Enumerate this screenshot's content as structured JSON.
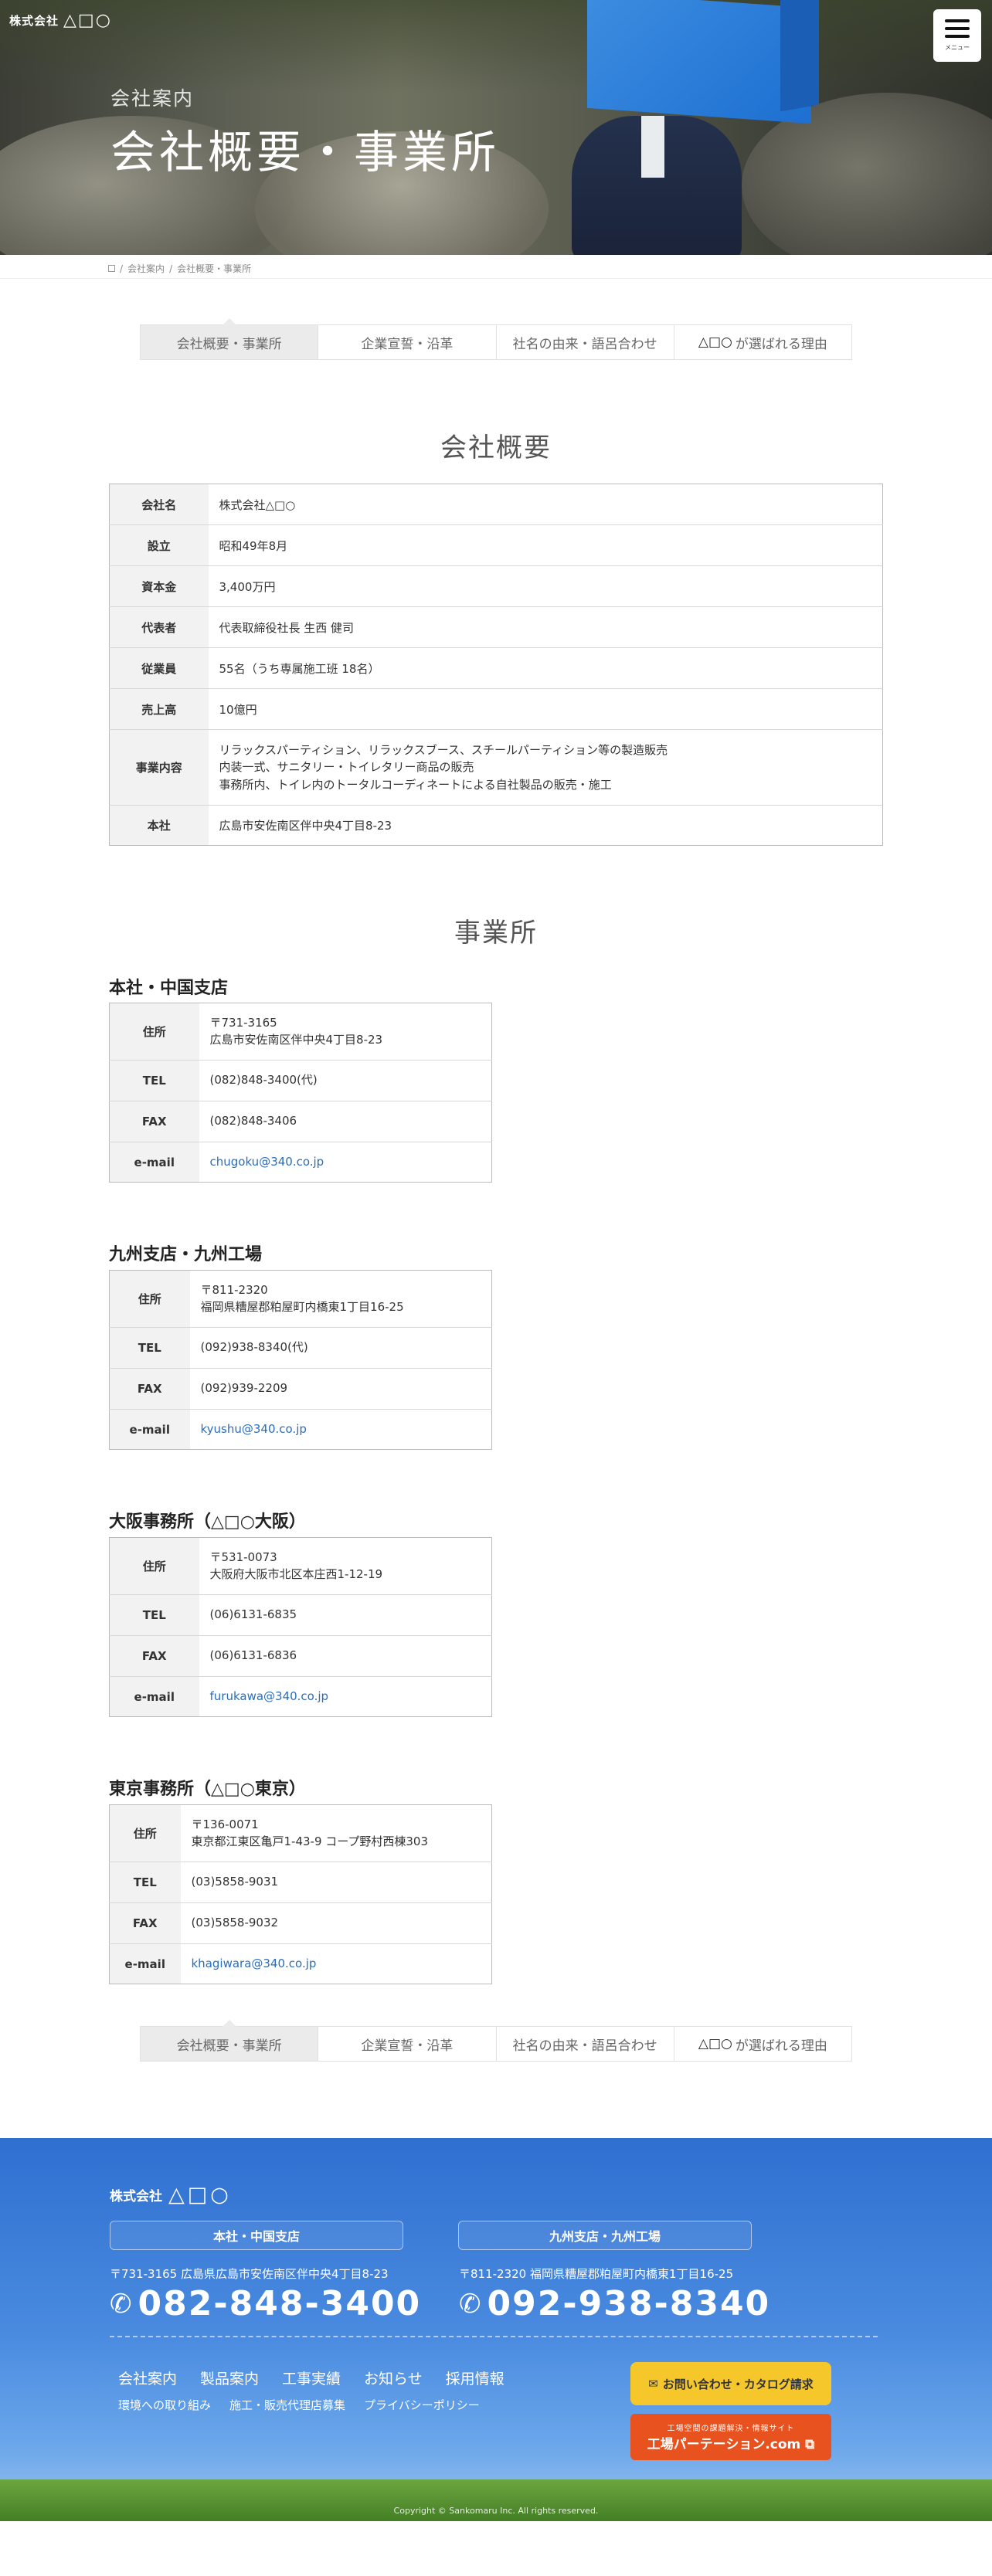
{
  "header": {
    "logo_company": "株式会社",
    "logo_marks": "△□○",
    "menu_label": "メニュー",
    "subtitle": "会社案内",
    "title": "会社概要・事業所"
  },
  "breadcrumb": {
    "items": [
      "会社案内",
      "会社概要・事業所"
    ]
  },
  "tabs": [
    {
      "label": "会社概要・事業所"
    },
    {
      "label": "企業宣誓・沿革"
    },
    {
      "label": "社名の由来・語呂合わせ"
    },
    {
      "label": "が選ばれる理由",
      "prefix": "△□○"
    }
  ],
  "company": {
    "title": "会社概要",
    "rows": [
      {
        "label": "会社名",
        "value": "株式会社△□○"
      },
      {
        "label": "設立",
        "value": "昭和49年8月"
      },
      {
        "label": "資本金",
        "value": "3,400万円"
      },
      {
        "label": "代表者",
        "value": "代表取締役社長 生西 健司"
      },
      {
        "label": "従業員",
        "value": "55名（うち専属施工班 18名）"
      },
      {
        "label": "売上高",
        "value": "10億円"
      },
      {
        "label": "事業内容",
        "line1": "リラックスパーティション、リラックスブース、スチールパーティション等の製造販売",
        "line2": "内装一式、サニタリー・トイレタリー商品の販売",
        "line3": "事務所内、トイレ内のトータルコーディネートによる自社製品の販売・施工"
      },
      {
        "label": "本社",
        "value": "広島市安佐南区伴中央4丁目8-23"
      }
    ]
  },
  "offices": {
    "title": "事業所",
    "labels": {
      "address": "住所",
      "tel": "TEL",
      "fax": "FAX",
      "email": "e-mail"
    },
    "list": [
      {
        "name": "本社・中国支店",
        "zip": "〒731-3165",
        "address": "広島市安佐南区伴中央4丁目8-23",
        "tel": "(082)848-3400(代)",
        "fax": "(082)848-3406",
        "email": "chugoku@340.co.jp"
      },
      {
        "name": "九州支店・九州工場",
        "zip": "〒811-2320",
        "address": "福岡県糟屋郡粕屋町内橋東1丁目16-25",
        "tel": "(092)938-8340(代)",
        "fax": "(092)939-2209",
        "email": "kyushu@340.co.jp"
      },
      {
        "name": "大阪事務所（△□○大阪）",
        "zip": "〒531-0073",
        "address": "大阪府大阪市北区本庄西1-12-19",
        "tel": "(06)6131-6835",
        "fax": "(06)6131-6836",
        "email": "furukawa@340.co.jp"
      },
      {
        "name": "東京事務所（△□○東京）",
        "zip": "〒136-0071",
        "address": "東京都江東区亀戸1-43-9 コープ野村西棟303",
        "tel": "(03)5858-9031",
        "fax": "(03)5858-9032",
        "email": "khagiwara@340.co.jp"
      }
    ]
  },
  "footer": {
    "logo_company": "株式会社",
    "logo_marks": "△□○",
    "branches": [
      {
        "name": "本社・中国支店",
        "address": "〒731-3165 広島県広島市安佐南区伴中央4丁目8-23",
        "tel": "082-848-3400"
      },
      {
        "name": "九州支店・九州工場",
        "address": "〒811-2320 福岡県糟屋郡粕屋町内橋東1丁目16-25",
        "tel": "092-938-8340"
      }
    ],
    "nav": [
      "会社案内",
      "製品案内",
      "工事実績",
      "お知らせ",
      "採用情報"
    ],
    "nav2": [
      "環境への取り組み",
      "施工・販売代理店募集",
      "プライバシーポリシー"
    ],
    "cta_contact": "お問い合わせ・カタログ請求",
    "cta_site_small": "工場空間の課題解決・情報サイト",
    "cta_site": "工場パーテーション.com",
    "copyright": "Copyright © Sankomaru Inc. All rights reserved."
  }
}
